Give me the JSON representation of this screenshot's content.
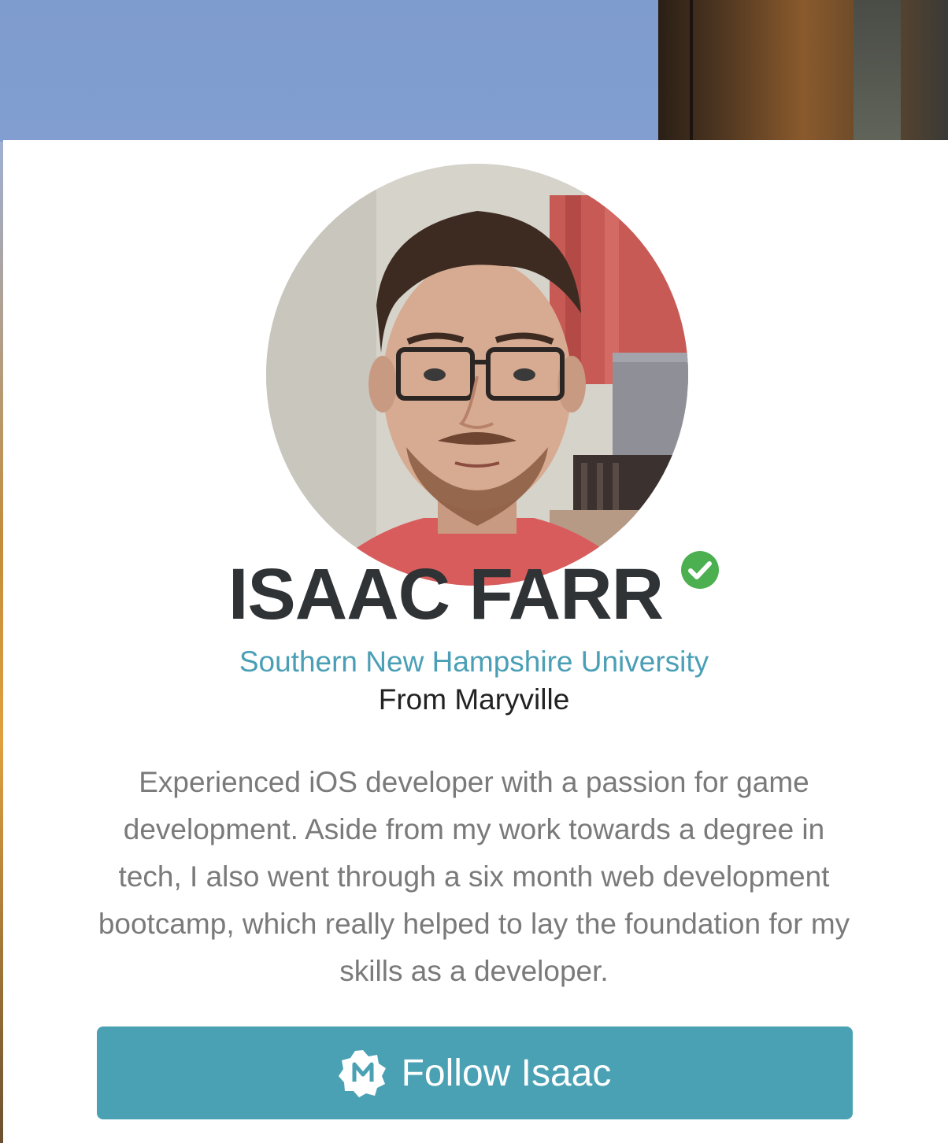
{
  "profile": {
    "name": "ISAAC FARR",
    "verified_icon": "verified-check-icon",
    "school": "Southern New Hampshire University",
    "hometown": "From Maryville",
    "bio": "Experienced iOS developer with a passion for game development. Aside from my work towards a degree in tech, I also went through a six month web development bootcamp, which really helped to lay the foundation for my skills as a developer.",
    "avatar_icon": "profile-photo"
  },
  "actions": {
    "follow_label": "Follow Isaac",
    "follow_icon": "m-badge-icon"
  },
  "colors": {
    "accent": "#4aa1b4",
    "verified": "#4caf50",
    "name_text": "#2f3336",
    "bio_text": "#7a7a7a"
  }
}
